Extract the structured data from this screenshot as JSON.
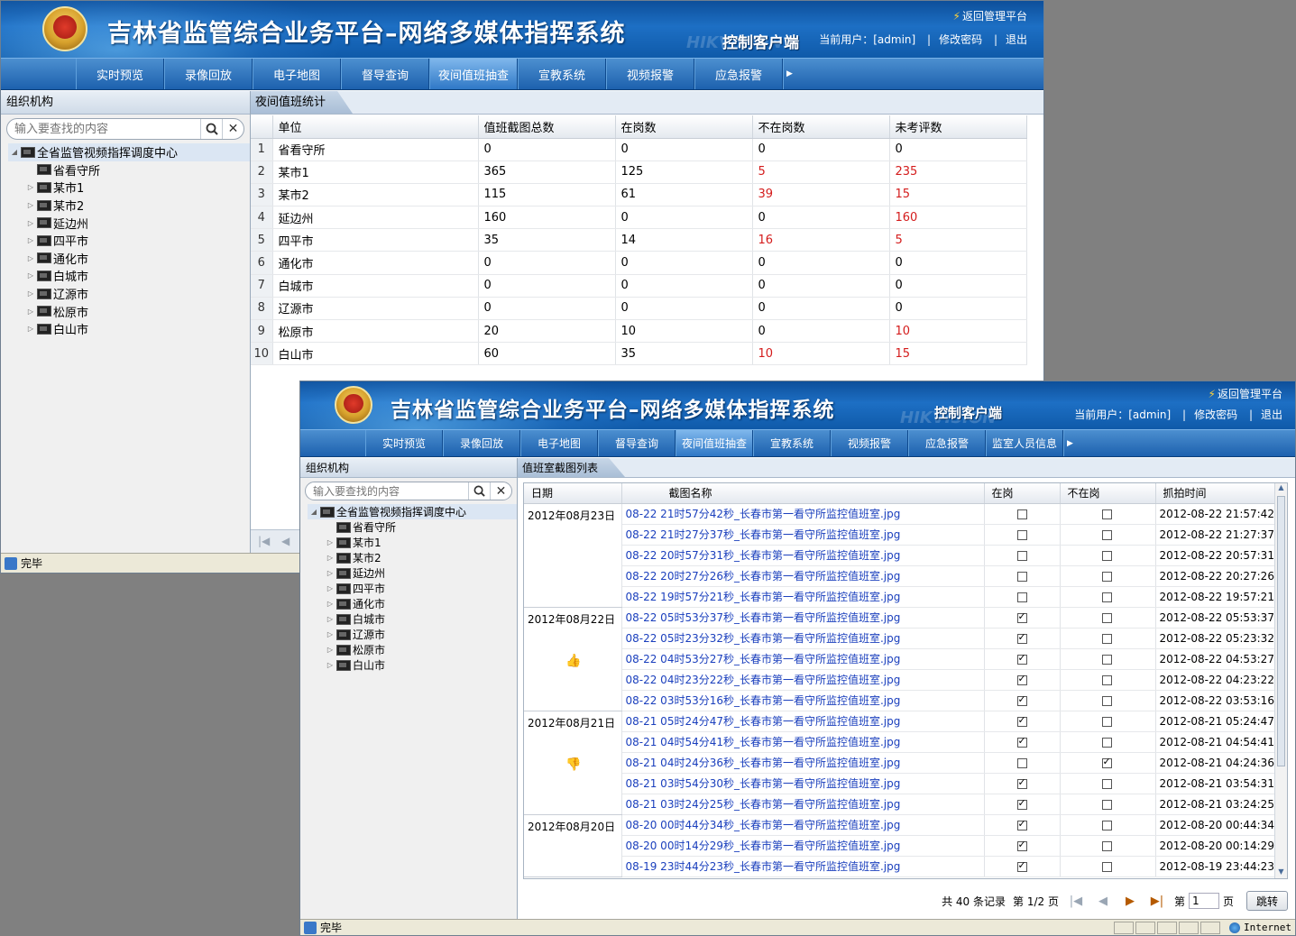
{
  "header": {
    "title": "吉林省监管综合业务平台–网络多媒体指挥系统",
    "client_label": "控制客户端",
    "return_link": "返回管理平台",
    "user_prefix": "当前用户：",
    "username": "[admin]",
    "change_password": "修改密码",
    "logout": "退出",
    "watermark": "HIKVISION"
  },
  "nav_a": [
    "实时预览",
    "录像回放",
    "电子地图",
    "督导查询",
    "夜间值班抽查",
    "宣教系统",
    "视频报警",
    "应急报警"
  ],
  "nav_b": [
    "实时预览",
    "录像回放",
    "电子地图",
    "督导查询",
    "夜间值班抽查",
    "宣教系统",
    "视频报警",
    "应急报警",
    "监室人员信息"
  ],
  "nav_active": "夜间值班抽查",
  "sidebar": {
    "title": "组织机构",
    "search_placeholder": "输入要查找的内容",
    "root": "全省监管视频指挥调度中心",
    "children": [
      "省看守所",
      "某市1",
      "某市2",
      "延边州",
      "四平市",
      "通化市",
      "白城市",
      "辽源市",
      "松原市",
      "白山市"
    ]
  },
  "stats": {
    "tab_label": "夜间值班统计",
    "columns": [
      "单位",
      "值班截图总数",
      "在岗数",
      "不在岗数",
      "未考评数"
    ],
    "rows": [
      {
        "n": "1",
        "unit": "省看守所",
        "total": "0",
        "on": "0",
        "off": "0",
        "unrated": "0"
      },
      {
        "n": "2",
        "unit": "某市1",
        "total": "365",
        "on": "125",
        "off": "5",
        "unrated": "235"
      },
      {
        "n": "3",
        "unit": "某市2",
        "total": "115",
        "on": "61",
        "off": "39",
        "unrated": "15"
      },
      {
        "n": "4",
        "unit": "延边州",
        "total": "160",
        "on": "0",
        "off": "0",
        "unrated": "160"
      },
      {
        "n": "5",
        "unit": "四平市",
        "total": "35",
        "on": "14",
        "off": "16",
        "unrated": "5"
      },
      {
        "n": "6",
        "unit": "通化市",
        "total": "0",
        "on": "0",
        "off": "0",
        "unrated": "0"
      },
      {
        "n": "7",
        "unit": "白城市",
        "total": "0",
        "on": "0",
        "off": "0",
        "unrated": "0"
      },
      {
        "n": "8",
        "unit": "辽源市",
        "total": "0",
        "on": "0",
        "off": "0",
        "unrated": "0"
      },
      {
        "n": "9",
        "unit": "松原市",
        "total": "20",
        "on": "10",
        "off": "0",
        "unrated": "10"
      },
      {
        "n": "10",
        "unit": "白山市",
        "total": "60",
        "on": "35",
        "off": "10",
        "unrated": "15"
      }
    ]
  },
  "shots": {
    "tab_label": "值班室截图列表",
    "columns": [
      "日期",
      "截图名称",
      "在岗",
      "不在岗",
      "抓拍时间"
    ],
    "groups": [
      {
        "date": "2012年08月23日",
        "icon": "",
        "rows": [
          {
            "name": "08-22 21时57分42秒_长春市第一看守所监控值班室.jpg",
            "on": false,
            "off": false,
            "time": "2012-08-22 21:57:42"
          },
          {
            "name": "08-22 21时27分37秒_长春市第一看守所监控值班室.jpg",
            "on": false,
            "off": false,
            "time": "2012-08-22 21:27:37"
          },
          {
            "name": "08-22 20时57分31秒_长春市第一看守所监控值班室.jpg",
            "on": false,
            "off": false,
            "time": "2012-08-22 20:57:31"
          },
          {
            "name": "08-22 20时27分26秒_长春市第一看守所监控值班室.jpg",
            "on": false,
            "off": false,
            "time": "2012-08-22 20:27:26"
          },
          {
            "name": "08-22 19时57分21秒_长春市第一看守所监控值班室.jpg",
            "on": false,
            "off": false,
            "time": "2012-08-22 19:57:21"
          }
        ]
      },
      {
        "date": "2012年08月22日",
        "icon": "thumbs-up",
        "rows": [
          {
            "name": "08-22 05时53分37秒_长春市第一看守所监控值班室.jpg",
            "on": true,
            "off": false,
            "time": "2012-08-22 05:53:37"
          },
          {
            "name": "08-22 05时23分32秒_长春市第一看守所监控值班室.jpg",
            "on": true,
            "off": false,
            "time": "2012-08-22 05:23:32"
          },
          {
            "name": "08-22 04时53分27秒_长春市第一看守所监控值班室.jpg",
            "on": true,
            "off": false,
            "time": "2012-08-22 04:53:27"
          },
          {
            "name": "08-22 04时23分22秒_长春市第一看守所监控值班室.jpg",
            "on": true,
            "off": false,
            "time": "2012-08-22 04:23:22"
          },
          {
            "name": "08-22 03时53分16秒_长春市第一看守所监控值班室.jpg",
            "on": true,
            "off": false,
            "time": "2012-08-22 03:53:16"
          }
        ]
      },
      {
        "date": "2012年08月21日",
        "icon": "thumbs-down",
        "rows": [
          {
            "name": "08-21 05时24分47秒_长春市第一看守所监控值班室.jpg",
            "on": true,
            "off": false,
            "time": "2012-08-21 05:24:47"
          },
          {
            "name": "08-21 04时54分41秒_长春市第一看守所监控值班室.jpg",
            "on": true,
            "off": false,
            "time": "2012-08-21 04:54:41"
          },
          {
            "name": "08-21 04时24分36秒_长春市第一看守所监控值班室.jpg",
            "on": false,
            "off": true,
            "time": "2012-08-21 04:24:36"
          },
          {
            "name": "08-21 03时54分30秒_长春市第一看守所监控值班室.jpg",
            "on": true,
            "off": false,
            "time": "2012-08-21 03:54:31"
          },
          {
            "name": "08-21 03时24分25秒_长春市第一看守所监控值班室.jpg",
            "on": true,
            "off": false,
            "time": "2012-08-21 03:24:25"
          }
        ]
      },
      {
        "date": "2012年08月20日",
        "icon": "",
        "rows": [
          {
            "name": "08-20 00时44分34秒_长春市第一看守所监控值班室.jpg",
            "on": true,
            "off": false,
            "time": "2012-08-20 00:44:34"
          },
          {
            "name": "08-20 00时14分29秒_长春市第一看守所监控值班室.jpg",
            "on": true,
            "off": false,
            "time": "2012-08-20 00:14:29"
          },
          {
            "name": "08-19 23时44分23秒_长春市第一看守所监控值班室.jpg",
            "on": true,
            "off": false,
            "time": "2012-08-19 23:44:23"
          }
        ]
      }
    ]
  },
  "pager": {
    "total_text": "共 40 条记录",
    "page_text": "第 1/2 页",
    "goto_prefix": "第",
    "goto_value": "1",
    "goto_suffix": "页",
    "jump_label": "跳转"
  },
  "status": {
    "text": "完毕",
    "zone": "Internet"
  },
  "colors": {
    "banner": "#1d6fc4",
    "highlight_red": "#d41c1c",
    "link_blue": "#1a3fbd"
  }
}
